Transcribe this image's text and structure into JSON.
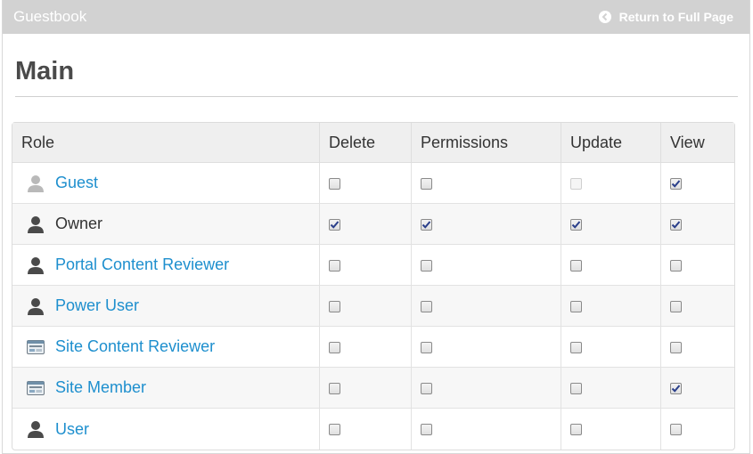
{
  "header": {
    "title": "Guestbook",
    "return_label": "Return to Full Page"
  },
  "section": {
    "title": "Main"
  },
  "table": {
    "columns": [
      "Role",
      "Delete",
      "Permissions",
      "Update",
      "View"
    ],
    "rows": [
      {
        "role": "Guest",
        "icon": "guest-user-icon",
        "link": true,
        "delete": false,
        "permissions": false,
        "update": false,
        "update_disabled": true,
        "view": true
      },
      {
        "role": "Owner",
        "icon": "user-icon",
        "link": false,
        "delete": true,
        "permissions": true,
        "update": true,
        "update_disabled": false,
        "view": true
      },
      {
        "role": "Portal Content Reviewer",
        "icon": "user-icon",
        "link": true,
        "delete": false,
        "permissions": false,
        "update": false,
        "update_disabled": false,
        "view": false
      },
      {
        "role": "Power User",
        "icon": "user-icon",
        "link": true,
        "delete": false,
        "permissions": false,
        "update": false,
        "update_disabled": false,
        "view": false
      },
      {
        "role": "Site Content Reviewer",
        "icon": "site-role-icon",
        "link": true,
        "delete": false,
        "permissions": false,
        "update": false,
        "update_disabled": false,
        "view": false
      },
      {
        "role": "Site Member",
        "icon": "site-role-icon",
        "link": true,
        "delete": false,
        "permissions": false,
        "update": false,
        "update_disabled": false,
        "view": true
      },
      {
        "role": "User",
        "icon": "user-icon",
        "link": true,
        "delete": false,
        "permissions": false,
        "update": false,
        "update_disabled": false,
        "view": false
      }
    ]
  }
}
